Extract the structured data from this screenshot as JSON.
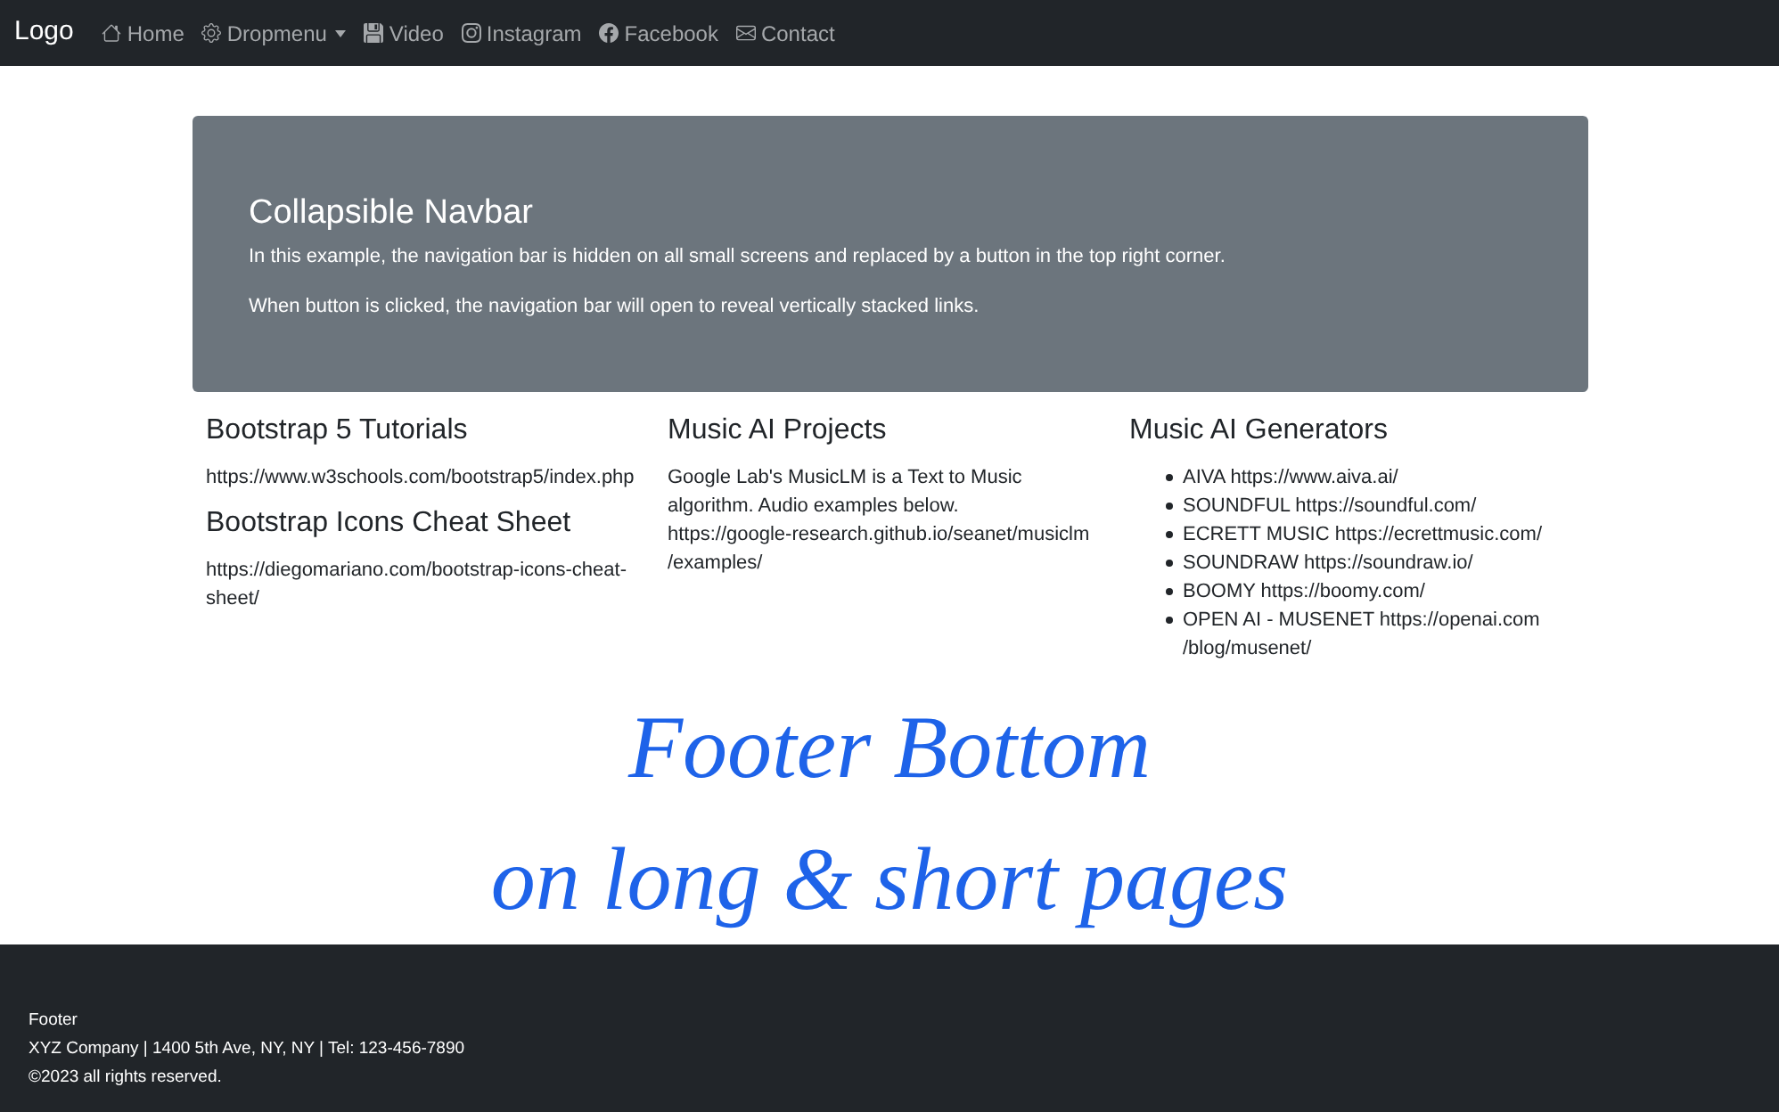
{
  "navbar": {
    "brand": "Logo",
    "items": [
      {
        "label": "Home",
        "dropdown": false
      },
      {
        "label": "Dropmenu",
        "dropdown": true
      },
      {
        "label": "Video",
        "dropdown": false
      },
      {
        "label": "Instagram",
        "dropdown": false
      },
      {
        "label": "Facebook",
        "dropdown": false
      },
      {
        "label": "Contact",
        "dropdown": false
      }
    ]
  },
  "jumbotron": {
    "title": "Collapsible Navbar",
    "paragraphs": [
      "In this example, the navigation bar is hidden on all small screens and replaced by a button in the top right corner.",
      "When button is clicked, the navigation bar will open to reveal vertically stacked links."
    ]
  },
  "columns": [
    {
      "sections": [
        {
          "heading": "Bootstrap 5 Tutorials",
          "lines": [
            "https://www.w3schools.com/bootstrap5/index.php"
          ]
        },
        {
          "heading": "Bootstrap Icons Cheat Sheet",
          "lines": [
            "https://diegomariano.com/bootstrap-icons-cheat-sheet/"
          ]
        }
      ]
    },
    {
      "sections": [
        {
          "heading": "Music AI Projects",
          "lines": [
            "Google Lab's MusicLM is a Text to Music algorithm. Audio examples below.",
            "https://google-research.github.io/seanet/musiclm /examples/"
          ]
        }
      ]
    },
    {
      "sections": [
        {
          "heading": "Music AI Generators",
          "list": [
            "AIVA https://www.aiva.ai/",
            "SOUNDFUL https://soundful.com/",
            "ECRETT MUSIC https://ecrettmusic.com/",
            "SOUNDRAW https://soundraw.io/",
            "BOOMY https://boomy.com/",
            "OPEN AI - MUSENET https://openai.com /blog/musenet/"
          ]
        }
      ]
    }
  ],
  "banner": [
    "Footer Bottom",
    "on long & short pages"
  ],
  "footer": [
    "Footer",
    "XYZ Company | 1400 5th Ave, NY, NY | Tel: 123-456-7890",
    "©2023 all rights reserved."
  ]
}
